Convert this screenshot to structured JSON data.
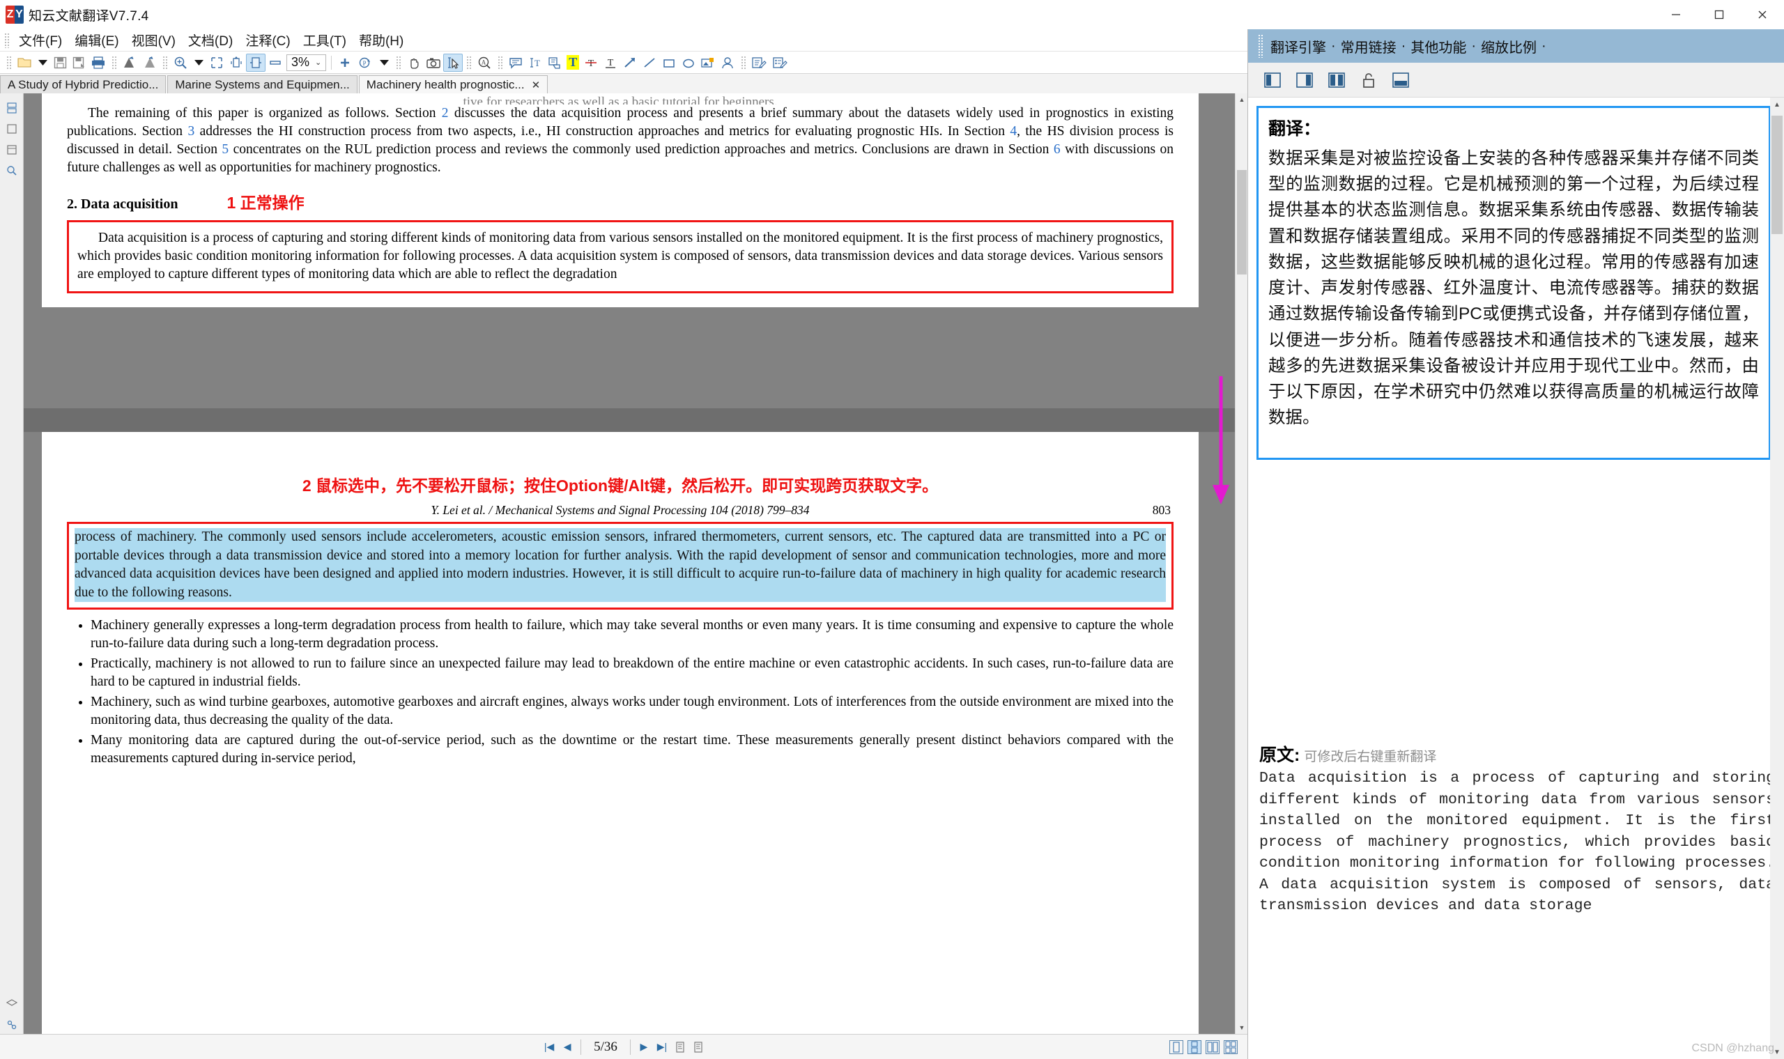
{
  "window": {
    "title": "知云文献翻译V7.7.4",
    "logo_left": "Z",
    "logo_right": "Y",
    "minimize": "—",
    "maximize": "❐",
    "close": "✕"
  },
  "menubar": {
    "items": [
      {
        "label": "文件(F)"
      },
      {
        "label": "编辑(E)"
      },
      {
        "label": "视图(V)"
      },
      {
        "label": "文档(D)"
      },
      {
        "label": "注释(C)"
      },
      {
        "label": "工具(T)"
      },
      {
        "label": "帮助(H)"
      }
    ]
  },
  "toolbar": {
    "zoom_value": "3%",
    "zoom_caret": "⌄",
    "highlight_letter": "T",
    "icons": [
      "open-folder-icon",
      "open-dropdown-caret",
      "save-icon",
      "save-as-icon",
      "print-icon",
      "undo-icon",
      "redo-icon",
      "zoom-in-icon",
      "zoom-dropdown-caret",
      "fit-page-icon",
      "fit-width-icon",
      "fit-visible-icon",
      "single-page-icon",
      "add-page-icon",
      "rotate-page-icon",
      "rotate-caret",
      "hand-tool-icon",
      "snapshot-icon",
      "select-text-icon",
      "find-icon",
      "note-icon",
      "text-edit-icon",
      "copy-region-icon",
      "highlight-text-icon",
      "strikeout-text-icon",
      "underline-text-icon",
      "arrow-draw-icon",
      "line-draw-icon",
      "rectangle-draw-icon",
      "ellipse-draw-icon",
      "stamp-image-icon",
      "signature-icon",
      "form-fill-icon",
      "form-edit-icon"
    ]
  },
  "tabs": [
    {
      "label": "A Study of Hybrid Predictio...",
      "active": false,
      "closable": false
    },
    {
      "label": "Marine Systems and Equipmen...",
      "active": false,
      "closable": false
    },
    {
      "label": "Machinery health prognostic...",
      "active": true,
      "closable": true,
      "close": "✕"
    }
  ],
  "rail": {
    "icons": [
      "thumbnails-icon",
      "bookmarks-icon",
      "attachments-icon",
      "search-icon",
      "layers-icon",
      "comments-icon"
    ]
  },
  "document": {
    "top_cut_line": "tive for researchers as well as a basic tutorial for beginners.",
    "intro_paragraph_parts": [
      "The remaining of this paper is organized as follows. Section ",
      "2",
      " discusses the data acquisition process and presents a brief summary about the datasets widely used in prognostics in existing publications. Section ",
      "3",
      " addresses the HI construction process from two aspects, i.e., HI construction approaches and metrics for evaluating prognostic HIs. In Section ",
      "4",
      ", the HS division process is discussed in detail. Section ",
      "5",
      " concentrates on the RUL prediction process and reviews the commonly used prediction approaches and metrics. Conclusions are drawn in Section ",
      "6",
      " with discussions on future challenges as well as opportunities for machinery prognostics."
    ],
    "section_heading": "2. Data acquisition",
    "annotation_1": "1 正常操作",
    "annotation_2": "2 鼠标选中，先不要松开鼠标；按住Option键/Alt键，然后松开。即可实现跨页获取文字。",
    "redbox_paragraph": "Data acquisition is a process of capturing and storing different kinds of monitoring data from various sensors installed on the monitored equipment. It is the first process of machinery prognostics, which provides basic condition monitoring information for following processes. A data acquisition system is composed of sensors, data transmission devices and data storage devices. Various sensors are employed to capture different types of monitoring data which are able to reflect the degradation",
    "journal_line": "Y. Lei et al. / Mechanical Systems and Signal Processing 104 (2018) 799–834",
    "journal_page_number": "803",
    "selected_paragraph": "process of machinery. The commonly used sensors include accelerometers, acoustic emission sensors, infrared thermometers, current sensors, etc. The captured data are transmitted into a PC or portable devices through a data transmission device and stored into a memory location for further analysis. With the rapid development of sensor and communication technologies, more and more advanced data acquisition devices have been designed and applied into modern industries. However, it is still difficult to acquire run-to-failure data of machinery in high quality for academic research due to the following reasons.",
    "bullets": [
      "Machinery generally expresses a long-term degradation process from health to failure, which may take several months or even many years. It is time consuming and expensive to capture the whole run-to-failure data during such a long-term degradation process.",
      "Practically, machinery is not allowed to run to failure since an unexpected failure may lead to breakdown of the entire machine or even catastrophic accidents. In such cases, run-to-failure data are hard to be captured in industrial fields.",
      "Machinery, such as wind turbine gearboxes, automotive gearboxes and aircraft engines, always works under tough environment. Lots of interferences from the outside environment are mixed into the monitoring data, thus decreasing the quality of the data.",
      "Many monitoring data are captured during the out-of-service period, such as the downtime or the restart time. These measurements generally present distinct behaviors compared with the measurements captured during in-service period,"
    ]
  },
  "statusbar": {
    "first_page": "|◀",
    "prev_page": "◀",
    "page_indicator": "5/36",
    "next_page": "▶",
    "last_page": "▶|",
    "goto_prev_view": "goto-previous-view-icon",
    "goto_next_view": "goto-next-view-icon",
    "view_modes": [
      "single-page-view-icon",
      "continuous-view-icon",
      "two-page-view-icon",
      "two-page-continuous-icon"
    ]
  },
  "right_panel": {
    "header_items": [
      "翻译引擎",
      "常用链接",
      "其他功能",
      "缩放比例"
    ],
    "header_separator": "·",
    "toolbar_icons": [
      "layout-left-icon",
      "layout-right-icon",
      "layout-split-icon",
      "unlock-icon",
      "layout-bottom-icon"
    ],
    "translation_label": "翻译：",
    "translation_text": "数据采集是对被监控设备上安装的各种传感器采集并存储不同类型的监测数据的过程。它是机械预测的第一个过程，为后续过程提供基本的状态监测信息。数据采集系统由传感器、数据传输装置和数据存储装置组成。采用不同的传感器捕捉不同类型的监测数据，这些数据能够反映机械的退化过程。常用的传感器有加速度计、声发射传感器、红外温度计、电流传感器等。捕获的数据通过数据传输设备传输到PC或便携式设备，并存储到存储位置，以便进一步分析。随着传感器技术和通信技术的飞速发展，越来越多的先进数据采集设备被设计并应用于现代工业中。然而，由于以下原因，在学术研究中仍然难以获得高质量的机械运行故障数据。",
    "original_label": "原文:",
    "original_hint": "可修改后右键重新翻译",
    "original_text": "Data acquisition is a process of capturing and storing different kinds of monitoring data from various sensors installed on the monitored equipment. It is the first process of machinery prognostics, which provides basic condition monitoring information for following processes. A data acquisition system is composed of sensors, data transmission devices and data storage",
    "watermark": "CSDN @hzhang"
  },
  "colors": {
    "annotation_red": "#ee1111",
    "selection_blue": "#addbf0",
    "panel_header": "#95b8d4",
    "translate_border": "#2196f3",
    "arrow_magenta": "#e21ad0",
    "link_blue": "#2a6fc9"
  }
}
